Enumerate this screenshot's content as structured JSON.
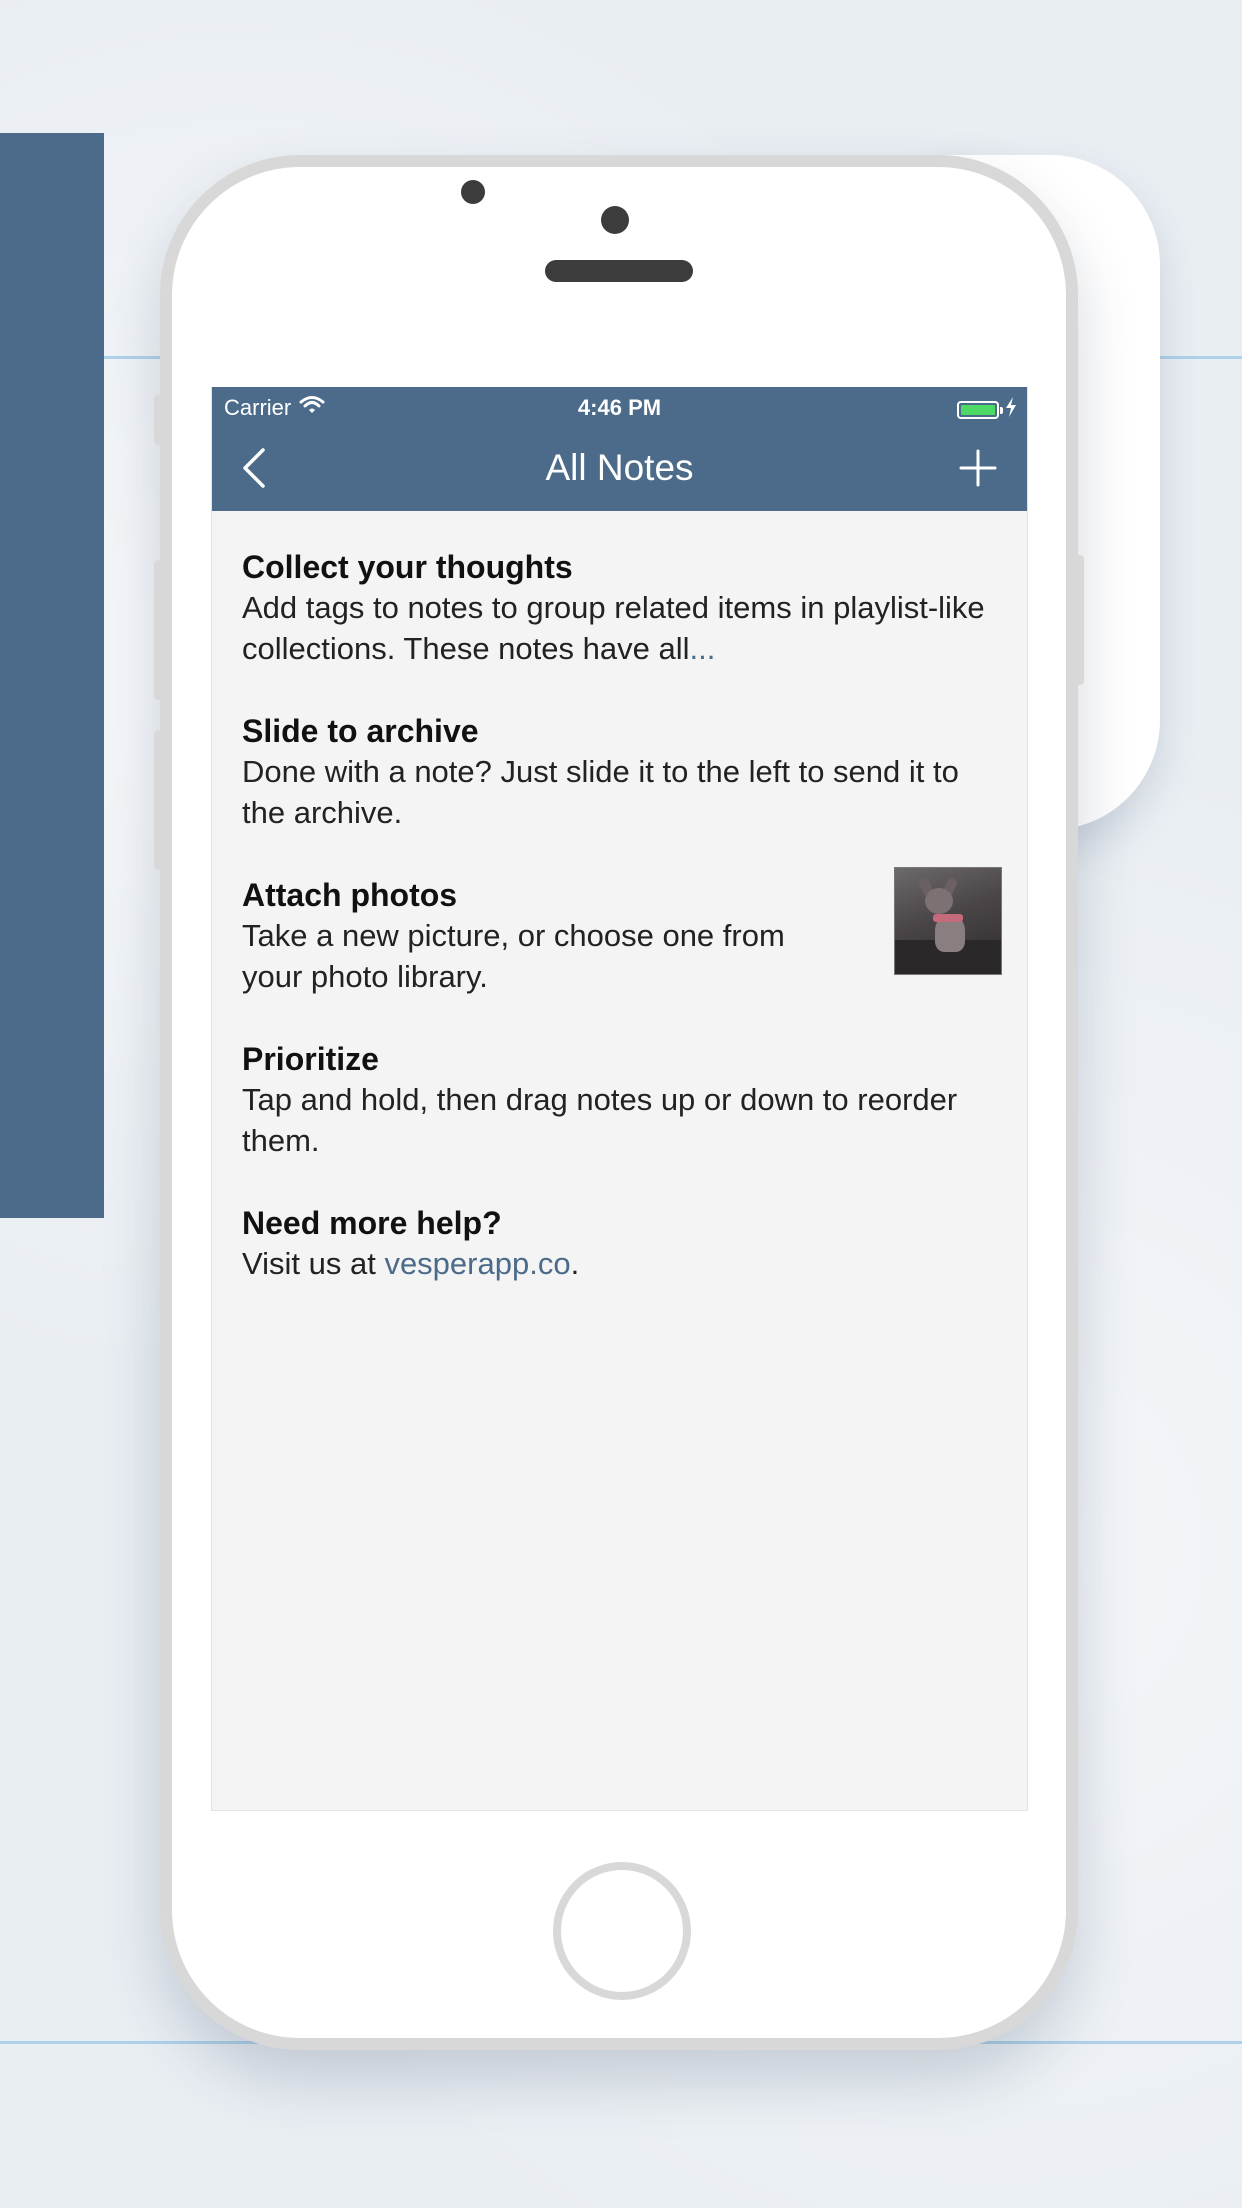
{
  "status_bar": {
    "carrier": "Carrier",
    "time": "4:46 PM"
  },
  "nav": {
    "title": "All Notes"
  },
  "notes": [
    {
      "title": "Collect your thoughts",
      "body": "Add tags to notes to group related items in playlist-like collections. These notes have all",
      "ellipsis": "..."
    },
    {
      "title": "Slide to archive",
      "body": "Done with a note? Just slide it to the left to send it to the archive."
    },
    {
      "title": "Attach photos",
      "body": "Take a new picture, or choose one from your photo library.",
      "has_photo": true
    },
    {
      "title": "Prioritize",
      "body": "Tap and hold, then drag notes up or down to reorder them."
    },
    {
      "title": "Need more help?",
      "body_prefix": "Visit us at ",
      "link": "vesperapp.co",
      "body_suffix": "."
    }
  ],
  "colors": {
    "accent": "#4c6b8a",
    "battery": "#4cd964",
    "screen_bg": "#f4f4f4"
  },
  "icons": {
    "back": "chevron-left-icon",
    "add": "plus-icon",
    "wifi": "wifi-icon",
    "battery": "battery-icon",
    "charging": "bolt-icon"
  }
}
